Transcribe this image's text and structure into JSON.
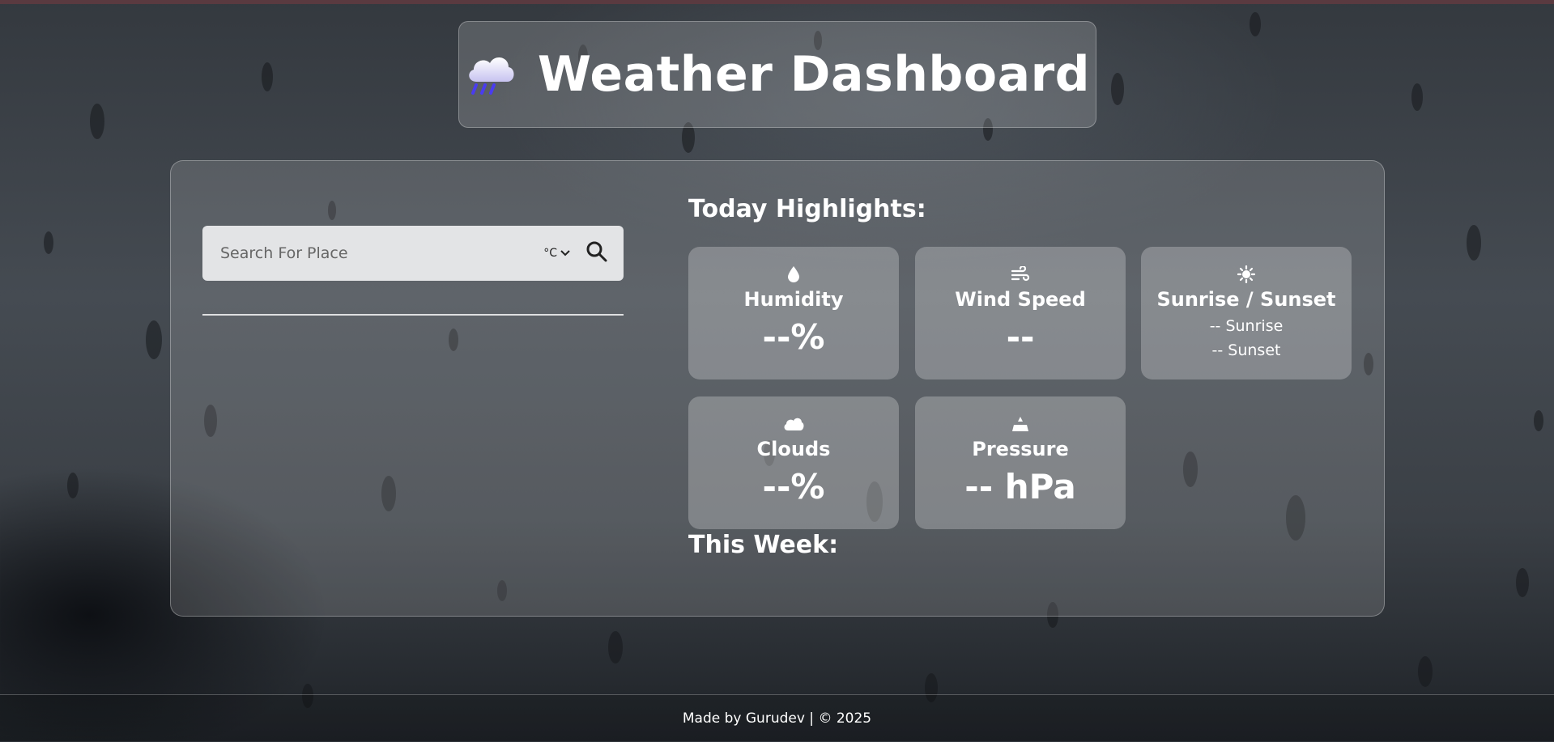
{
  "app": {
    "title": "Weather Dashboard",
    "logo_icon": "cloud-rain-icon"
  },
  "search": {
    "placeholder": "Search For Place",
    "unit": "°C",
    "button_icon": "search-icon"
  },
  "highlights": {
    "title": "Today Highlights:",
    "humidity": {
      "label": "Humidity",
      "value": "--%"
    },
    "wind": {
      "label": "Wind Speed",
      "value": "--"
    },
    "sun": {
      "label": "Sunrise / Sunset",
      "sunrise": "-- Sunrise",
      "sunset": "-- Sunset"
    },
    "clouds": {
      "label": "Clouds",
      "value": "--%"
    },
    "pressure": {
      "label": "Pressure",
      "value": "-- hPa"
    }
  },
  "week": {
    "title": "This Week:"
  },
  "footer": {
    "text": "Made by Gurudev | © 2025"
  }
}
